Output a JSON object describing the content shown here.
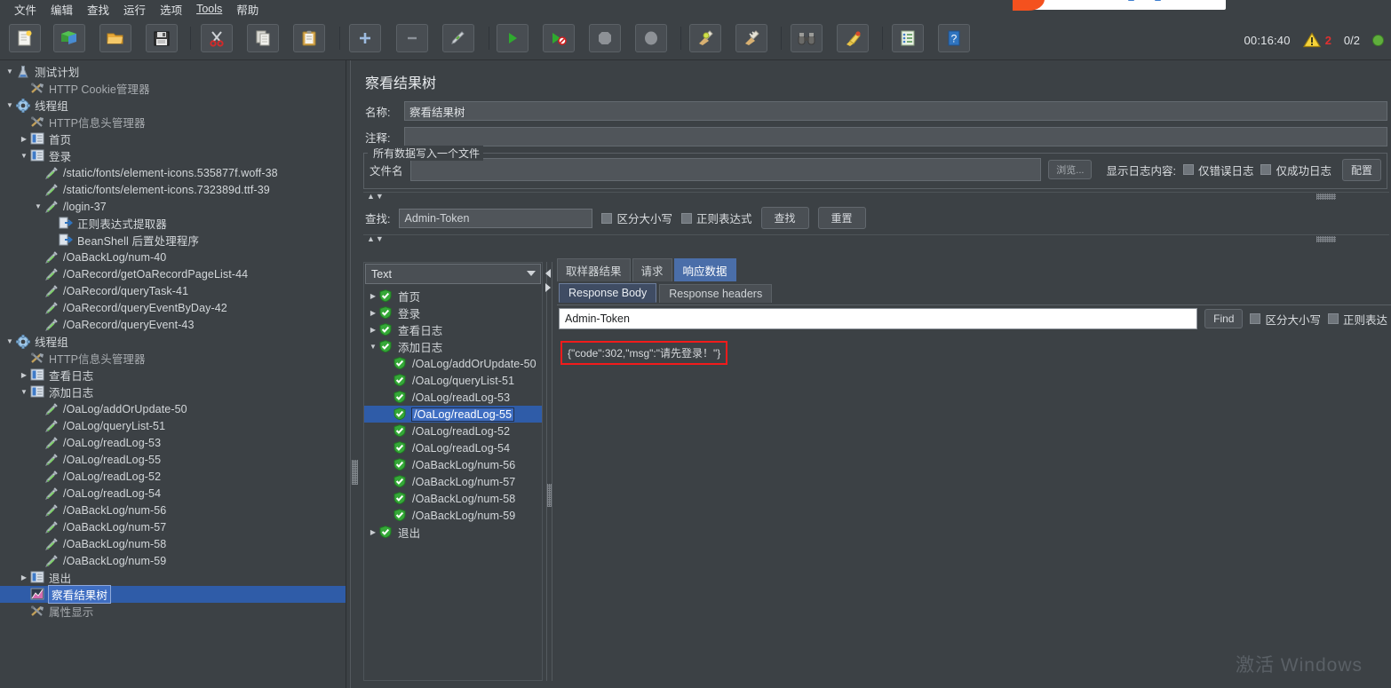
{
  "menu": {
    "items": [
      {
        "label": "文件",
        "name": "menu-file"
      },
      {
        "label": "编辑",
        "name": "menu-edit"
      },
      {
        "label": "查找",
        "name": "menu-search"
      },
      {
        "label": "运行",
        "name": "menu-run"
      },
      {
        "label": "选项",
        "name": "menu-options"
      },
      {
        "label": "Tools",
        "name": "menu-tools",
        "mnemonic": "T"
      },
      {
        "label": "帮助",
        "name": "menu-help"
      }
    ]
  },
  "toolbar": {
    "buttons": [
      {
        "name": "new-icon",
        "tip": "新建"
      },
      {
        "name": "templates-icon",
        "tip": "模板"
      },
      {
        "name": "open-icon",
        "tip": "打开"
      },
      {
        "name": "save-icon",
        "tip": "保存"
      },
      {
        "name": "cut-icon",
        "tip": "剪切"
      },
      {
        "name": "copy-icon",
        "tip": "复制"
      },
      {
        "name": "paste-icon",
        "tip": "粘贴"
      },
      {
        "name": "expand-all-icon",
        "tip": "展开全部"
      },
      {
        "name": "collapse-all-icon",
        "tip": "折叠全部"
      },
      {
        "name": "toggle-icon",
        "tip": "启用/禁用"
      },
      {
        "name": "start-icon",
        "tip": "启动"
      },
      {
        "name": "start-no-pauses-icon",
        "tip": "无间隔启动"
      },
      {
        "name": "stop-icon",
        "tip": "停止"
      },
      {
        "name": "shutdown-icon",
        "tip": "关闭"
      },
      {
        "name": "clear-icon",
        "tip": "清除"
      },
      {
        "name": "clear-all-icon",
        "tip": "清除全部"
      },
      {
        "name": "search-icon",
        "tip": "查找"
      },
      {
        "name": "search-reset-icon",
        "tip": "重置查找"
      },
      {
        "name": "function-helper-icon",
        "tip": "函数助手对话框"
      },
      {
        "name": "help-icon",
        "tip": "帮助"
      }
    ],
    "elapsed_time": "00:16:40",
    "warning_count": "2",
    "thread_count": "0/2"
  },
  "tree": {
    "nodes": [
      {
        "depth": 0,
        "twist": "▼",
        "icon": "test-plan-icon",
        "label": "测试计划",
        "name": "tree-node-test-plan"
      },
      {
        "depth": 1,
        "twist": "",
        "icon": "config-element-icon",
        "label": "HTTP Cookie管理器",
        "name": "tree-node-http-cookie-manager",
        "dim": true
      },
      {
        "depth": 0,
        "twist": "▼",
        "icon": "thread-group-icon",
        "label": "线程组",
        "name": "tree-node-thread-group-1"
      },
      {
        "depth": 1,
        "twist": "",
        "icon": "config-element-icon",
        "label": "HTTP信息头管理器",
        "name": "tree-node-http-header-manager-1",
        "dim": true
      },
      {
        "depth": 1,
        "twist": "▶",
        "icon": "controller-icon",
        "label": "首页",
        "name": "tree-node-controller-home"
      },
      {
        "depth": 1,
        "twist": "▼",
        "icon": "controller-icon",
        "label": "登录",
        "name": "tree-node-controller-login"
      },
      {
        "depth": 2,
        "twist": "",
        "icon": "http-sampler-icon",
        "label": "/static/fonts/element-icons.535877f.woff-38",
        "name": "tree-node-sampler-woff-38"
      },
      {
        "depth": 2,
        "twist": "",
        "icon": "http-sampler-icon",
        "label": "/static/fonts/element-icons.732389d.ttf-39",
        "name": "tree-node-sampler-ttf-39"
      },
      {
        "depth": 2,
        "twist": "▼",
        "icon": "http-sampler-icon",
        "label": "/login-37",
        "name": "tree-node-sampler-login-37"
      },
      {
        "depth": 3,
        "twist": "",
        "icon": "post-processor-icon",
        "label": "正则表达式提取器",
        "name": "tree-node-regex-extractor"
      },
      {
        "depth": 3,
        "twist": "",
        "icon": "post-processor-icon",
        "label": "BeanShell 后置处理程序",
        "name": "tree-node-beanshell-postprocessor"
      },
      {
        "depth": 2,
        "twist": "",
        "icon": "http-sampler-icon",
        "label": "/OaBackLog/num-40",
        "name": "tree-node-sampler-oabacklog-num-40"
      },
      {
        "depth": 2,
        "twist": "",
        "icon": "http-sampler-icon",
        "label": "/OaRecord/getOaRecordPageList-44",
        "name": "tree-node-sampler-getoarecordpagelist-44"
      },
      {
        "depth": 2,
        "twist": "",
        "icon": "http-sampler-icon",
        "label": "/OaRecord/queryTask-41",
        "name": "tree-node-sampler-querytask-41"
      },
      {
        "depth": 2,
        "twist": "",
        "icon": "http-sampler-icon",
        "label": "/OaRecord/queryEventByDay-42",
        "name": "tree-node-sampler-queryeventbyday-42"
      },
      {
        "depth": 2,
        "twist": "",
        "icon": "http-sampler-icon",
        "label": "/OaRecord/queryEvent-43",
        "name": "tree-node-sampler-queryevent-43"
      },
      {
        "depth": 0,
        "twist": "▼",
        "icon": "thread-group-icon",
        "label": "线程组",
        "name": "tree-node-thread-group-2"
      },
      {
        "depth": 1,
        "twist": "",
        "icon": "config-element-icon",
        "label": "HTTP信息头管理器",
        "name": "tree-node-http-header-manager-2",
        "dim": true
      },
      {
        "depth": 1,
        "twist": "▶",
        "icon": "controller-icon",
        "label": "查看日志",
        "name": "tree-node-controller-view-log"
      },
      {
        "depth": 1,
        "twist": "▼",
        "icon": "controller-icon",
        "label": "添加日志",
        "name": "tree-node-controller-add-log"
      },
      {
        "depth": 2,
        "twist": "",
        "icon": "http-sampler-icon",
        "label": "/OaLog/addOrUpdate-50",
        "name": "tree-node-sampler-addorupdate-50"
      },
      {
        "depth": 2,
        "twist": "",
        "icon": "http-sampler-icon",
        "label": "/OaLog/queryList-51",
        "name": "tree-node-sampler-querylist-51"
      },
      {
        "depth": 2,
        "twist": "",
        "icon": "http-sampler-icon",
        "label": "/OaLog/readLog-53",
        "name": "tree-node-sampler-readlog-53"
      },
      {
        "depth": 2,
        "twist": "",
        "icon": "http-sampler-icon",
        "label": "/OaLog/readLog-55",
        "name": "tree-node-sampler-readlog-55"
      },
      {
        "depth": 2,
        "twist": "",
        "icon": "http-sampler-icon",
        "label": "/OaLog/readLog-52",
        "name": "tree-node-sampler-readlog-52"
      },
      {
        "depth": 2,
        "twist": "",
        "icon": "http-sampler-icon",
        "label": "/OaLog/readLog-54",
        "name": "tree-node-sampler-readlog-54"
      },
      {
        "depth": 2,
        "twist": "",
        "icon": "http-sampler-icon",
        "label": "/OaBackLog/num-56",
        "name": "tree-node-sampler-oabacklog-num-56"
      },
      {
        "depth": 2,
        "twist": "",
        "icon": "http-sampler-icon",
        "label": "/OaBackLog/num-57",
        "name": "tree-node-sampler-oabacklog-num-57"
      },
      {
        "depth": 2,
        "twist": "",
        "icon": "http-sampler-icon",
        "label": "/OaBackLog/num-58",
        "name": "tree-node-sampler-oabacklog-num-58"
      },
      {
        "depth": 2,
        "twist": "",
        "icon": "http-sampler-icon",
        "label": "/OaBackLog/num-59",
        "name": "tree-node-sampler-oabacklog-num-59"
      },
      {
        "depth": 1,
        "twist": "▶",
        "icon": "controller-icon",
        "label": "退出",
        "name": "tree-node-controller-logout"
      },
      {
        "depth": 1,
        "twist": "",
        "icon": "view-results-tree-icon",
        "label": "察看结果树",
        "name": "tree-node-view-results-tree",
        "selected": true
      },
      {
        "depth": 1,
        "twist": "",
        "icon": "config-element-icon",
        "label": "属性显示",
        "name": "tree-node-property-display",
        "dim": true
      }
    ]
  },
  "panel": {
    "title": "察看结果树",
    "name_label": "名称:",
    "name_value": "察看结果树",
    "comment_label": "注释:",
    "comment_value": "",
    "filegroup_title": "所有数据写入一个文件",
    "filename_label": "文件名",
    "filename_value": "",
    "browse_label": "浏览...",
    "display_log_label": "显示日志内容:",
    "errors_only_label": "仅错误日志",
    "successes_only_label": "仅成功日志",
    "configure_label": "配置"
  },
  "search": {
    "label": "查找:",
    "value": "Admin-Token",
    "case_sensitive_label": "区分大小写",
    "regex_label": "正则表达式",
    "find_label": "查找",
    "reset_label": "重置"
  },
  "results": {
    "renderer_selected": "Text",
    "nodes": [
      {
        "depth": 0,
        "twist": "▶",
        "label": "首页",
        "name": "result-node-home"
      },
      {
        "depth": 0,
        "twist": "▶",
        "label": "登录",
        "name": "result-node-login"
      },
      {
        "depth": 0,
        "twist": "▶",
        "label": "查看日志",
        "name": "result-node-view-log"
      },
      {
        "depth": 0,
        "twist": "▼",
        "label": "添加日志",
        "name": "result-node-add-log"
      },
      {
        "depth": 1,
        "twist": "",
        "label": "/OaLog/addOrUpdate-50",
        "name": "result-node-addorupdate-50"
      },
      {
        "depth": 1,
        "twist": "",
        "label": "/OaLog/queryList-51",
        "name": "result-node-querylist-51"
      },
      {
        "depth": 1,
        "twist": "",
        "label": "/OaLog/readLog-53",
        "name": "result-node-readlog-53"
      },
      {
        "depth": 1,
        "twist": "",
        "label": "/OaLog/readLog-55",
        "name": "result-node-readlog-55",
        "selected": true
      },
      {
        "depth": 1,
        "twist": "",
        "label": "/OaLog/readLog-52",
        "name": "result-node-readlog-52"
      },
      {
        "depth": 1,
        "twist": "",
        "label": "/OaLog/readLog-54",
        "name": "result-node-readlog-54"
      },
      {
        "depth": 1,
        "twist": "",
        "label": "/OaBackLog/num-56",
        "name": "result-node-oabacklog-num-56"
      },
      {
        "depth": 1,
        "twist": "",
        "label": "/OaBackLog/num-57",
        "name": "result-node-oabacklog-num-57"
      },
      {
        "depth": 1,
        "twist": "",
        "label": "/OaBackLog/num-58",
        "name": "result-node-oabacklog-num-58"
      },
      {
        "depth": 1,
        "twist": "",
        "label": "/OaBackLog/num-59",
        "name": "result-node-oabacklog-num-59"
      },
      {
        "depth": 0,
        "twist": "▶",
        "label": "退出",
        "name": "result-node-logout"
      }
    ]
  },
  "detail": {
    "tabs": [
      {
        "label": "取样器结果",
        "name": "tab-sampler-result",
        "active": false
      },
      {
        "label": "请求",
        "name": "tab-request",
        "active": false
      },
      {
        "label": "响应数据",
        "name": "tab-response-data",
        "active": true
      }
    ],
    "subtabs": [
      {
        "label": "Response Body",
        "name": "tab-response-body",
        "active": true
      },
      {
        "label": "Response headers",
        "name": "tab-response-headers",
        "active": false
      }
    ],
    "find_value": "Admin-Token",
    "find_button": "Find",
    "case_sensitive_label": "区分大小写",
    "regex_label": "正则表达",
    "response_body": "{\"code\":302,\"msg\":\"请先登录！\"}"
  },
  "watermark": "激活 Windows",
  "colors": {
    "bg": "#3c4145",
    "selection": "#2f5ca8",
    "tab_active": "#4a6ea9",
    "highlight_border": "#f21b1b",
    "warning_red": "#e03030",
    "success_green": "#5fae3c"
  }
}
